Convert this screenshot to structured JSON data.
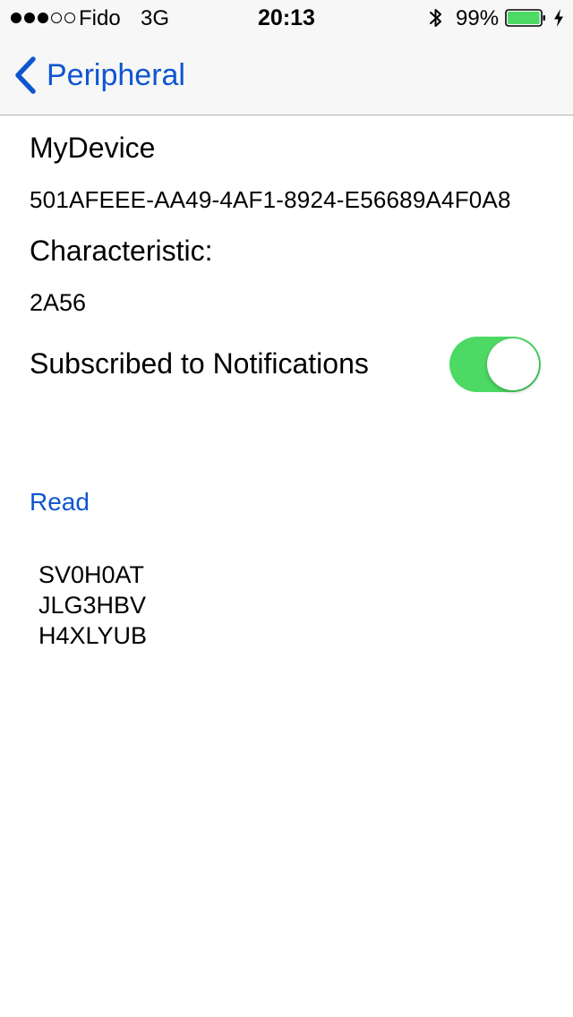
{
  "status_bar": {
    "signal_filled": 3,
    "signal_total": 5,
    "carrier": "Fido",
    "network": "3G",
    "time": "20:13",
    "bluetooth_icon": "bluetooth-icon",
    "battery_percent_label": "99%",
    "battery_level": 0.99,
    "charging_icon": "bolt-icon",
    "battery_color": "#4cd964"
  },
  "nav": {
    "back_label": "Peripheral",
    "back_icon": "chevron-left-icon",
    "accent_color": "#0f55cf"
  },
  "device": {
    "name": "MyDevice",
    "uuid": "501AFEEE-AA49-4AF1-8924-E56689A4F0A8"
  },
  "characteristic": {
    "heading": "Characteristic:",
    "uuid": "2A56"
  },
  "notifications": {
    "label": "Subscribed to Notifications",
    "enabled": true,
    "toggle_color": "#4cd964"
  },
  "actions": {
    "read_label": "Read"
  },
  "values": [
    "SV0H0AT",
    "JLG3HBV",
    "H4XLYUB"
  ]
}
